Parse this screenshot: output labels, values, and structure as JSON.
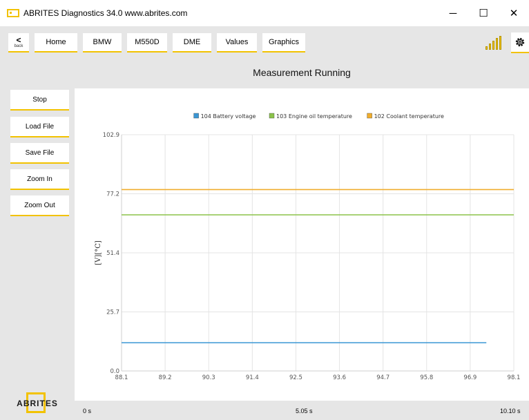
{
  "window": {
    "title": "ABRITES Diagnostics 34.0   www.abrites.com",
    "minimize": "─",
    "maximize": "☐",
    "close": "✕"
  },
  "toolbar": {
    "back_chevron": "<",
    "back_label": "back",
    "tabs": [
      "Home",
      "BMW",
      "M550D",
      "DME",
      "Values",
      "Graphics"
    ]
  },
  "status_title": "Measurement Running",
  "side_buttons": [
    "Stop",
    "Load File",
    "Save File",
    "Zoom In",
    "Zoom Out"
  ],
  "logo_text": "ABRITES",
  "timeline": {
    "start": "0 s",
    "mid": "5.05 s",
    "end": "10.10 s"
  },
  "chart_data": {
    "type": "line",
    "ylabel": "[V][°C]",
    "ylim": [
      0.0,
      102.9
    ],
    "xlim": [
      88.1,
      98.1
    ],
    "yticks": [
      "0.0",
      "25.7",
      "51.4",
      "77.2",
      "102.9"
    ],
    "xticks": [
      "88.1",
      "89.2",
      "90.3",
      "91.4",
      "92.5",
      "93.6",
      "94.7",
      "95.8",
      "96.9",
      "98.1"
    ],
    "legend_position": "top",
    "series": [
      {
        "name": "104 Battery voltage",
        "color": "#3a96d4",
        "x": [
          88.1,
          97.4
        ],
        "y": [
          12.3,
          12.3
        ]
      },
      {
        "name": "103 Engine oil temperature",
        "color": "#8bc34a",
        "x": [
          88.1,
          98.1
        ],
        "y": [
          68.0,
          68.0
        ]
      },
      {
        "name": "102 Coolant temperature",
        "color": "#f0ad2c",
        "x": [
          88.1,
          98.1
        ],
        "y": [
          79.0,
          79.0
        ]
      }
    ]
  }
}
